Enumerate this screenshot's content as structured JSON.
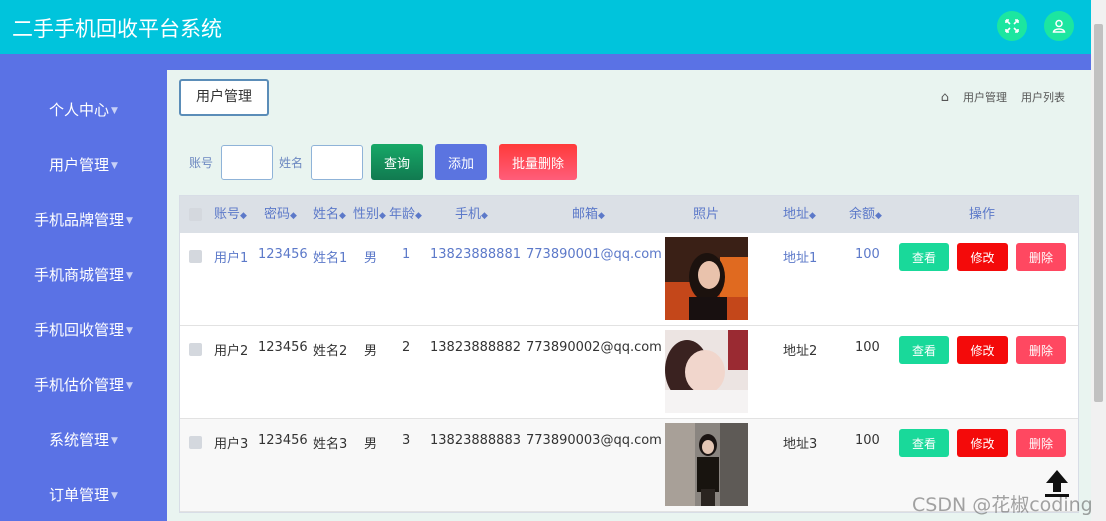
{
  "header": {
    "title": "二手手机回收平台系统",
    "fullscreen_icon": "expand-icon",
    "user_icon": "user-icon"
  },
  "sidebar": {
    "items": [
      {
        "label": "个人中心"
      },
      {
        "label": "用户管理"
      },
      {
        "label": "手机品牌管理"
      },
      {
        "label": "手机商城管理"
      },
      {
        "label": "手机回收管理"
      },
      {
        "label": "手机估价管理"
      },
      {
        "label": "系统管理"
      },
      {
        "label": "订单管理"
      }
    ]
  },
  "page": {
    "tab_label": "用户管理",
    "breadcrumb": [
      "用户管理",
      "用户列表"
    ]
  },
  "search": {
    "account_label": "账号",
    "account_value": "",
    "name_label": "姓名",
    "name_value": "",
    "query_label": "查询",
    "add_label": "添加",
    "batch_delete_label": "批量删除"
  },
  "table": {
    "columns": [
      "账号",
      "密码",
      "姓名",
      "性别",
      "年龄",
      "手机",
      "邮箱",
      "照片",
      "地址",
      "余额",
      "操作"
    ],
    "rows": [
      {
        "account": "用户1",
        "password": "123456",
        "name": "姓名1",
        "gender": "男",
        "age": "1",
        "phone": "13823888881",
        "email": "773890001@qq.com",
        "address": "地址1",
        "balance": "100"
      },
      {
        "account": "用户2",
        "password": "123456",
        "name": "姓名2",
        "gender": "男",
        "age": "2",
        "phone": "13823888882",
        "email": "773890002@qq.com",
        "address": "地址2",
        "balance": "100"
      },
      {
        "account": "用户3",
        "password": "123456",
        "name": "姓名3",
        "gender": "男",
        "age": "3",
        "phone": "13823888883",
        "email": "773890003@qq.com",
        "address": "地址3",
        "balance": "100"
      }
    ],
    "actions": {
      "view": "查看",
      "edit": "修改",
      "delete": "删除"
    }
  },
  "watermark": "CSDN @花椒coding",
  "colors": {
    "header": "#00c4dc",
    "sidebar": "#5a72e5",
    "query": "#17a867",
    "add": "#5b74e0",
    "batch_delete": "#ff3a3a",
    "view": "#19d99a",
    "edit": "#f40a0a",
    "delete": "#ff4861"
  }
}
